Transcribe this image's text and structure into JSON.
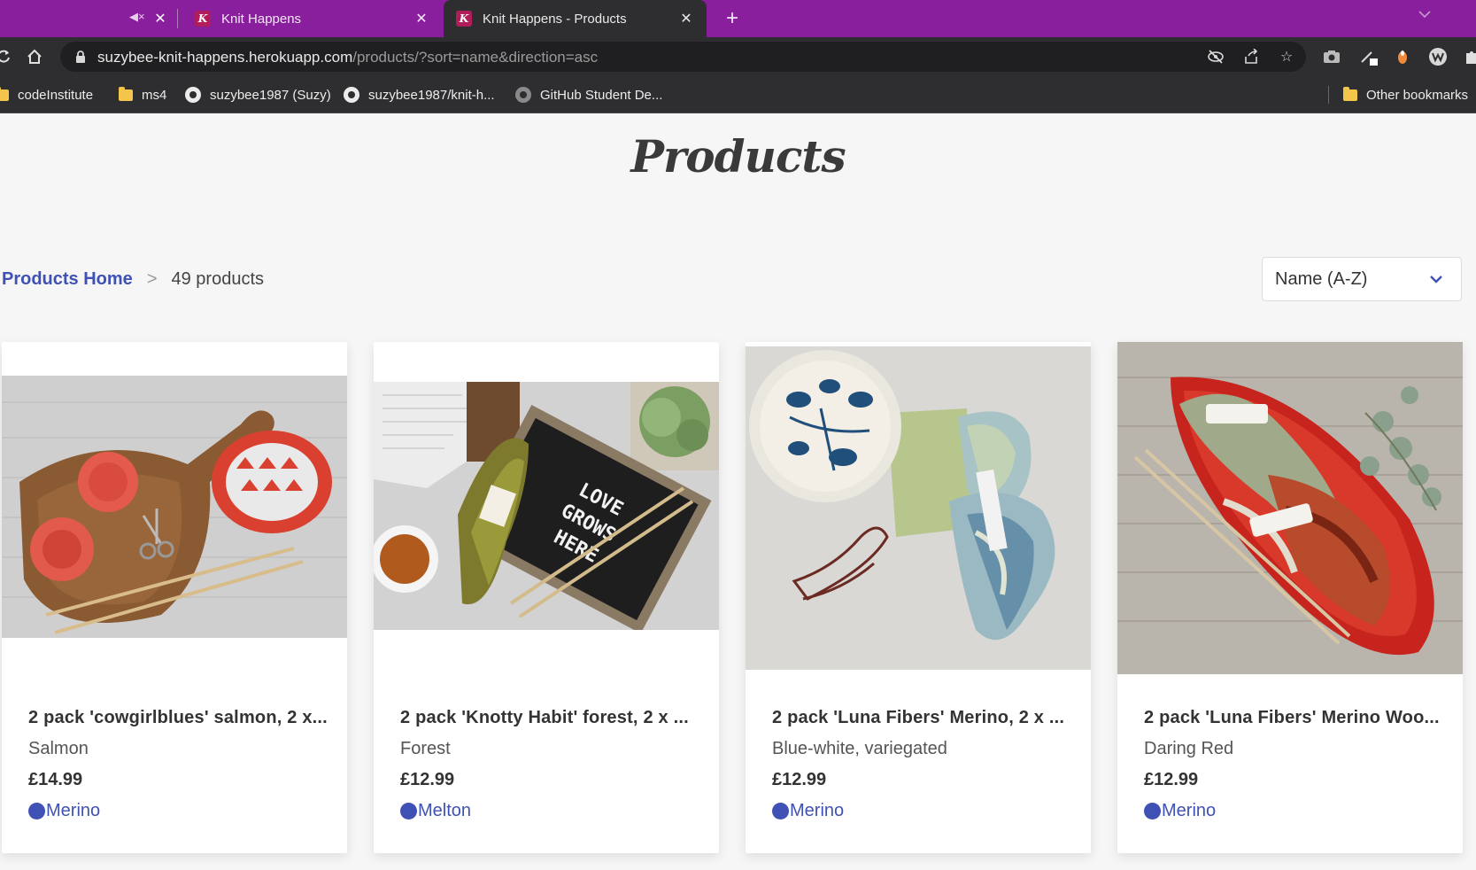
{
  "browser": {
    "tabs": [
      {
        "title": "",
        "active": false
      },
      {
        "title": "Knit Happens",
        "active": false
      },
      {
        "title": "Knit Happens - Products",
        "active": true
      }
    ],
    "favicon_letter": "K",
    "url_host": "suzybee-knit-happens.herokuapp.com",
    "url_path": "/products/?sort=name&direction=asc",
    "bookmarks": [
      {
        "label": "codeInstitute",
        "icon": "folder-icon"
      },
      {
        "label": "ms4",
        "icon": "folder-icon"
      },
      {
        "label": "suzybee1987 (Suzy)",
        "icon": "github-icon"
      },
      {
        "label": "suzybee1987/knit-h...",
        "icon": "github-icon"
      },
      {
        "label": "GitHub Student De...",
        "icon": "github-icon"
      }
    ],
    "other_bookmarks": "Other bookmarks"
  },
  "page": {
    "title": "Products",
    "breadcrumb": {
      "home": "Products Home",
      "separator": ">",
      "count": "49 products"
    },
    "sort": {
      "selected": "Name (A-Z)"
    }
  },
  "products": [
    {
      "name": "2 pack 'cowgirlblues' salmon, 2 x...",
      "colour": "Salmon",
      "price": "£14.99",
      "tag": "Merino"
    },
    {
      "name": "2 pack 'Knotty Habit' forest, 2 x ...",
      "colour": "Forest",
      "price": "£12.99",
      "tag": "Melton"
    },
    {
      "name": "2 pack 'Luna Fibers' Merino, 2 x ...",
      "colour": "Blue-white, variegated",
      "price": "£12.99",
      "tag": "Merino"
    },
    {
      "name": "2 pack 'Luna Fibers' Merino Woo...",
      "colour": "Daring Red",
      "price": "£12.99",
      "tag": "Merino"
    }
  ],
  "colors": {
    "tab_strip": "#8a1f9e",
    "chrome_dark": "#2e2e30",
    "link_blue": "#3f51b5",
    "page_bg": "#f6f6f6"
  }
}
